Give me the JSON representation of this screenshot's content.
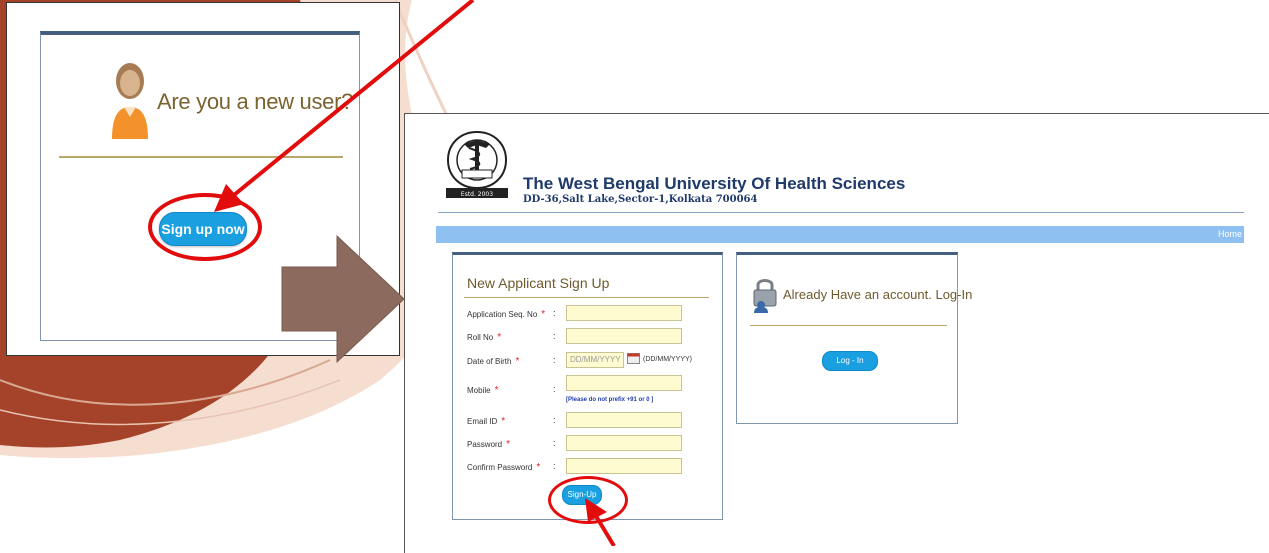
{
  "left_panel": {
    "question": "Are you a new user?",
    "signup_now_label": "Sign up now"
  },
  "header": {
    "title": "The West Bengal University Of Health Sciences",
    "address": "DD-36,Salt Lake,Sector-1,Kolkata 700064",
    "logo_text": "Estd. 2003"
  },
  "nav": {
    "home_label": "Home"
  },
  "signup_form": {
    "title": "New Applicant Sign Up",
    "required_mark": "*",
    "colon": ":",
    "fields": [
      {
        "label": "Application Seq. No",
        "value": ""
      },
      {
        "label": "Roll No",
        "value": ""
      },
      {
        "label": "Date of Birth",
        "placeholder": "DD/MM/YYYY",
        "format_hint": "(DD/MM/YYYY)"
      },
      {
        "label": "Mobile",
        "value": "",
        "hint": "[Please do not prefix +91 or 0 ]"
      },
      {
        "label": "Email ID",
        "value": ""
      },
      {
        "label": "Password",
        "value": ""
      },
      {
        "label": "Confirm Password",
        "value": ""
      }
    ],
    "submit_label": "Sign-Up"
  },
  "login_box": {
    "title": "Already Have an account. Log-In",
    "button_label": "Log - In"
  },
  "colors": {
    "accent_blue": "#1a9fe0",
    "annotation_red": "#e30c0c",
    "nav_blue": "#8ec1f2",
    "title_navy": "#1f3a6b",
    "slide_brown": "#9c3b22"
  }
}
